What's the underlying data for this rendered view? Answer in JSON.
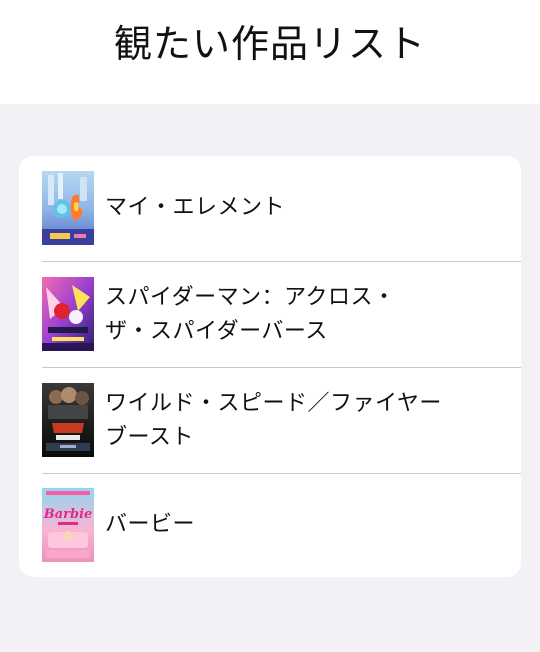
{
  "header": {
    "title": "観たい作品リスト"
  },
  "list": {
    "items": [
      {
        "title": "マイ・エレメント",
        "poster_icon": "poster-elemental"
      },
      {
        "title": "スパイダーマン：アクロス・\nザ・スパイダーバース",
        "poster_icon": "poster-spiderverse"
      },
      {
        "title": "ワイルド・スピード／ファイヤー\nブースト",
        "poster_icon": "poster-fastx"
      },
      {
        "title": "バービー",
        "poster_icon": "poster-barbie",
        "poster_text": "Barbie"
      }
    ]
  }
}
